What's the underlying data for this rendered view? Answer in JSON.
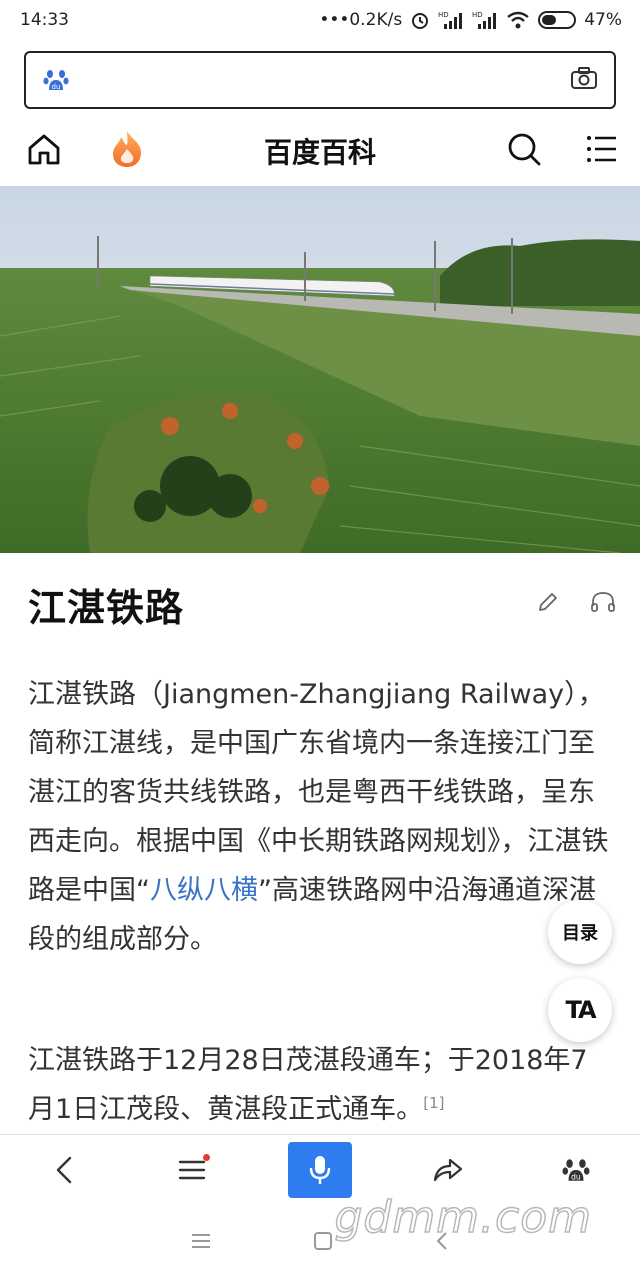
{
  "status_bar": {
    "time": "14:33",
    "network_speed": "•••0.2K/s",
    "battery": "47%",
    "icons": [
      "alarm-icon",
      "hd-signal-icon",
      "hd-signal-icon",
      "wifi-icon",
      "battery-icon"
    ]
  },
  "search": {
    "placeholder": "",
    "icons": [
      "baidu-paw-icon",
      "camera-icon"
    ]
  },
  "nav": {
    "title": "百度百科",
    "icons": [
      "home-icon",
      "hot-flame-icon",
      "search-icon",
      "menu-icon"
    ]
  },
  "hero": {
    "image": "high-speed-train-farmland-photo"
  },
  "article": {
    "title": "江湛铁路",
    "actions": [
      "edit-pencil-icon",
      "listen-headphones-icon"
    ],
    "para1_a": "江湛铁路（Jiangmen-Zhangjiang Railway），简称江湛线，是中国广东省境内一条连接江门至湛江的客货共线铁路，也是粤西干线铁路，呈东西走向。根据中国《中长期铁路网规划》，江湛铁路是中国“",
    "para1_link": "八纵八横",
    "para1_b": "”高速铁路网中沿海通道深湛段的组成部分。",
    "para2": "江湛铁路于12月28日茂湛段通车；于2018年7月1日江茂段、黄湛段正式通车。",
    "para2_ref": "[1]"
  },
  "floating": {
    "toc_label": "目录",
    "ta_label": "TA"
  },
  "toolbar": {
    "icons": [
      "back-arrow-icon",
      "menu-list-icon",
      "microphone-icon",
      "share-icon",
      "baidu-paw-icon"
    ],
    "accent_color": "#2f7cf0"
  },
  "system_nav": {
    "icons": [
      "recents-menu-icon",
      "home-square-icon",
      "back-chevron-icon"
    ]
  },
  "watermark": "gdmm.com"
}
